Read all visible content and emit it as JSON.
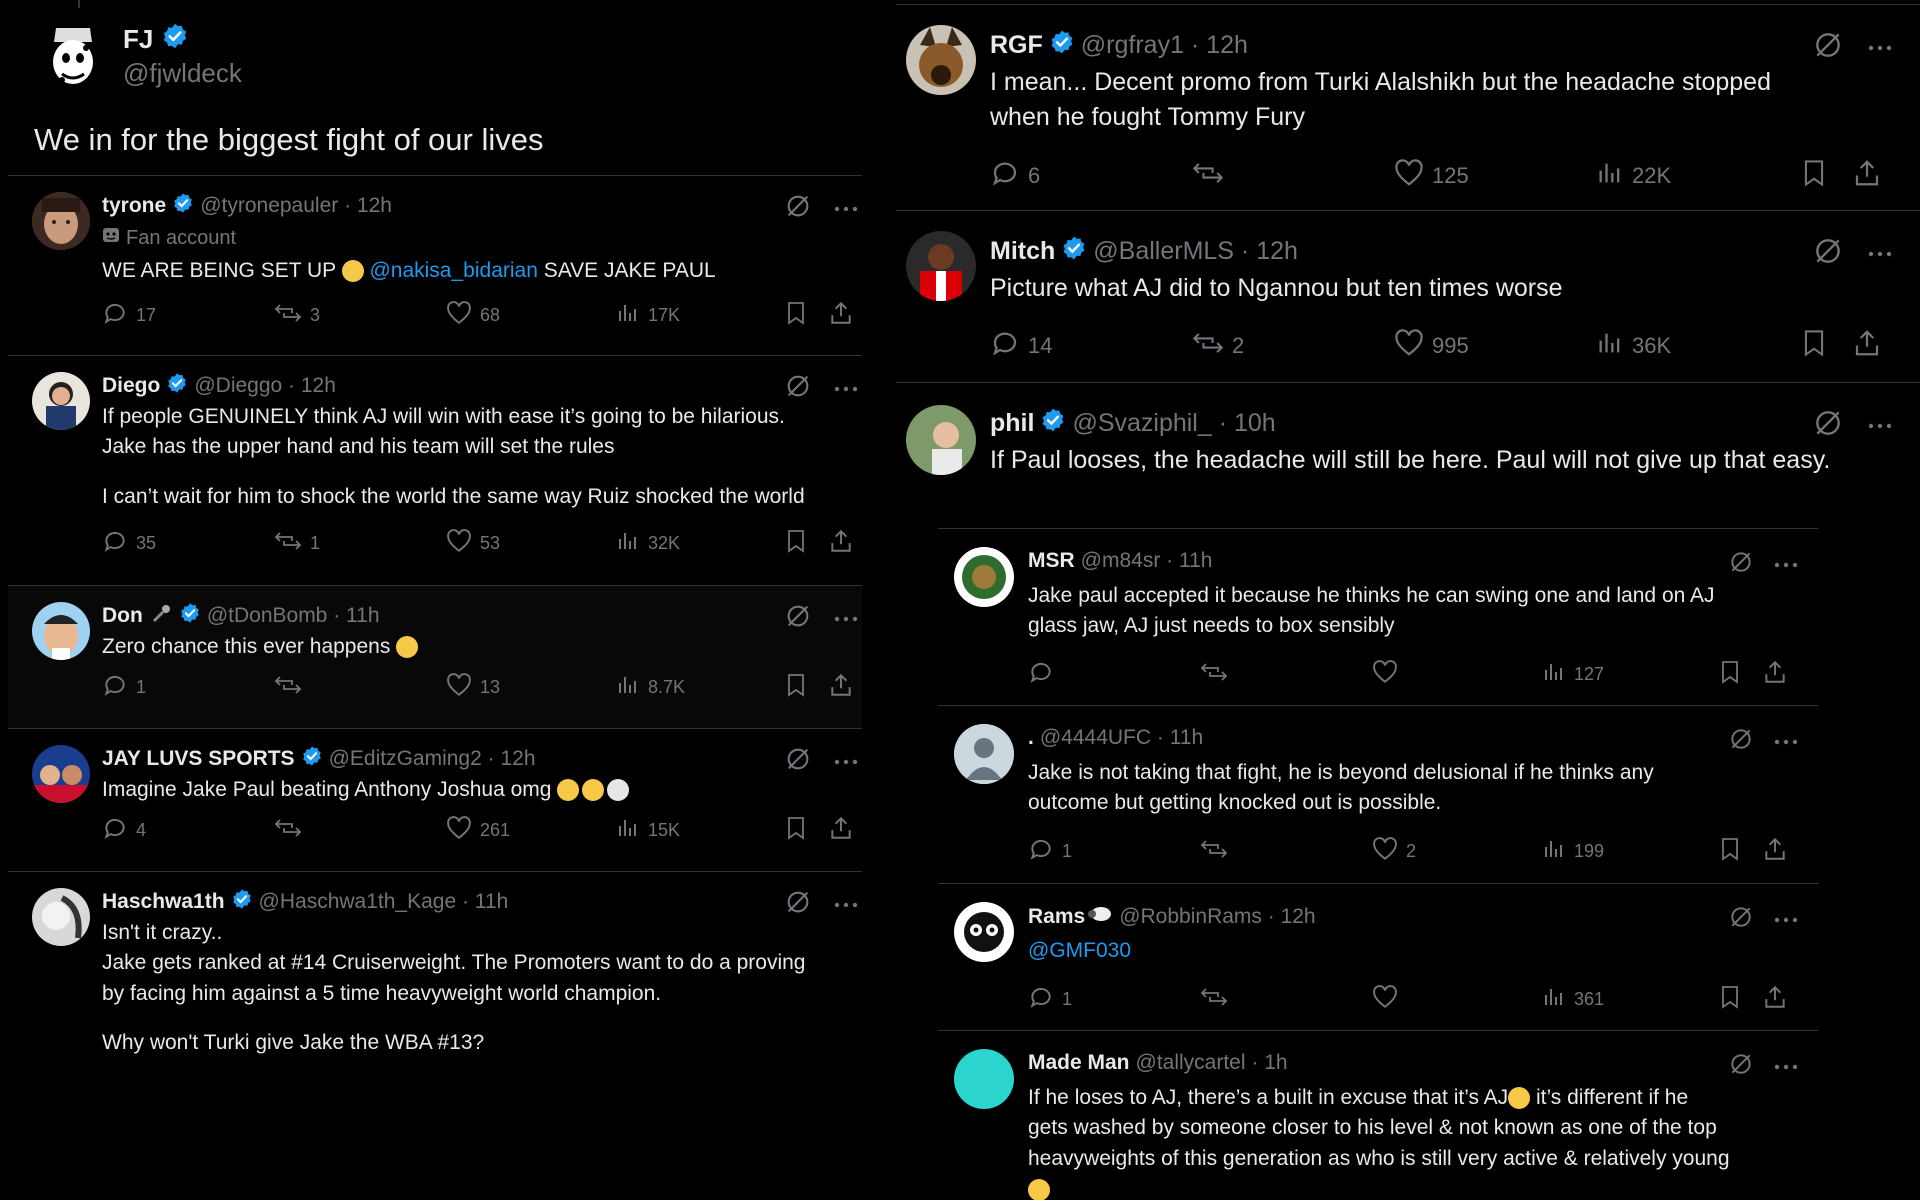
{
  "main_post": {
    "name": "FJ",
    "handle": "@fjwldeck",
    "text": "We in for the biggest fight of our lives"
  },
  "left_replies": [
    {
      "name": "tyrone",
      "handle": "@tyronepauler · 12h",
      "sub": "Fan account",
      "text_pre": "WE ARE BEING SET UP ",
      "mention": "@nakisa_bidarian",
      "text_post": " SAVE JAKE PAUL",
      "replies": "17",
      "reposts": "3",
      "likes": "68",
      "views": "17K"
    },
    {
      "name": "Diego",
      "handle": "@Dieggo · 12h",
      "line1": "If people GENUINELY think AJ will win with ease it’s going to be hilarious.",
      "line2": "Jake has the upper hand and his team will set the rules",
      "line3": "I can’t wait for him to shock the world the same way Ruiz shocked the world",
      "replies": "35",
      "reposts": "1",
      "likes": "53",
      "views": "32K"
    },
    {
      "name": "Don",
      "handle": "@tDonBomb · 11h",
      "text": "Zero chance this ever happens",
      "replies": "1",
      "reposts": "",
      "likes": "13",
      "views": "8.7K"
    },
    {
      "name": "JAY LUVS SPORTS",
      "handle": "@EditzGaming2 · 12h",
      "text": "Imagine Jake Paul beating Anthony Joshua omg",
      "replies": "4",
      "reposts": "",
      "likes": "261",
      "views": "15K"
    },
    {
      "name": "Haschwa1th",
      "handle": "@Haschwa1th_Kage · 11h",
      "line1": "Isn't it crazy..",
      "line2": "Jake gets ranked at #14 Cruiserweight. The Promoters want to do a proving",
      "line3": "by facing him against a 5 time heavyweight world champion.",
      "line4": "Why won't Turki give Jake the WBA #13?"
    }
  ],
  "right_replies": [
    {
      "name": "RGF",
      "handle": "@rgfray1 · 12h",
      "line1": "I mean... Decent promo from Turki Alalshikh but the headache stopped",
      "line2": "when he fought Tommy Fury",
      "replies": "6",
      "reposts": "",
      "likes": "125",
      "views": "22K"
    },
    {
      "name": "Mitch",
      "handle": "@BallerMLS · 12h",
      "text": "Picture what AJ did to Ngannou but ten times worse",
      "replies": "14",
      "reposts": "2",
      "likes": "995",
      "views": "36K"
    },
    {
      "name": "phil",
      "handle": "@Svaziphil_ · 10h",
      "text": "If Paul looses, the headache will still be here. Paul will not give up that easy."
    }
  ],
  "nested_replies": [
    {
      "name": "MSR",
      "handle": "@m84sr · 11h",
      "line1": "Jake paul accepted it because he thinks he can swing one and land on AJ",
      "line2": "glass jaw, AJ just needs to box sensibly",
      "replies": "",
      "reposts": "",
      "likes": "",
      "views": "127"
    },
    {
      "name": ".",
      "handle": "@4444UFC · 11h",
      "line1": "Jake is not taking that fight, he is beyond delusional if he thinks any",
      "line2": "outcome but getting knocked out is possible.",
      "replies": "1",
      "reposts": "",
      "likes": "2",
      "views": "199"
    },
    {
      "name": "Rams",
      "handle": "@RobbinRams · 12h",
      "mention": "@GMF030",
      "replies": "1",
      "reposts": "",
      "likes": "",
      "views": "361"
    },
    {
      "name": "Made Man",
      "handle": "@tallycartel · 1h",
      "line1": "If he loses to AJ, there’s a built in excuse that it’s AJ",
      "line1b": " it’s different if he",
      "line2": "gets washed by someone closer to his level & not known as one of the top",
      "line3": "heavyweights of this generation as who is still very active & relatively young"
    }
  ],
  "colors": {
    "background": "#000000",
    "text": "#e7e9ea",
    "muted": "#71767b",
    "verified": "#1d9bf0",
    "divider": "#2f3336",
    "mention": "#1d9bf0"
  }
}
